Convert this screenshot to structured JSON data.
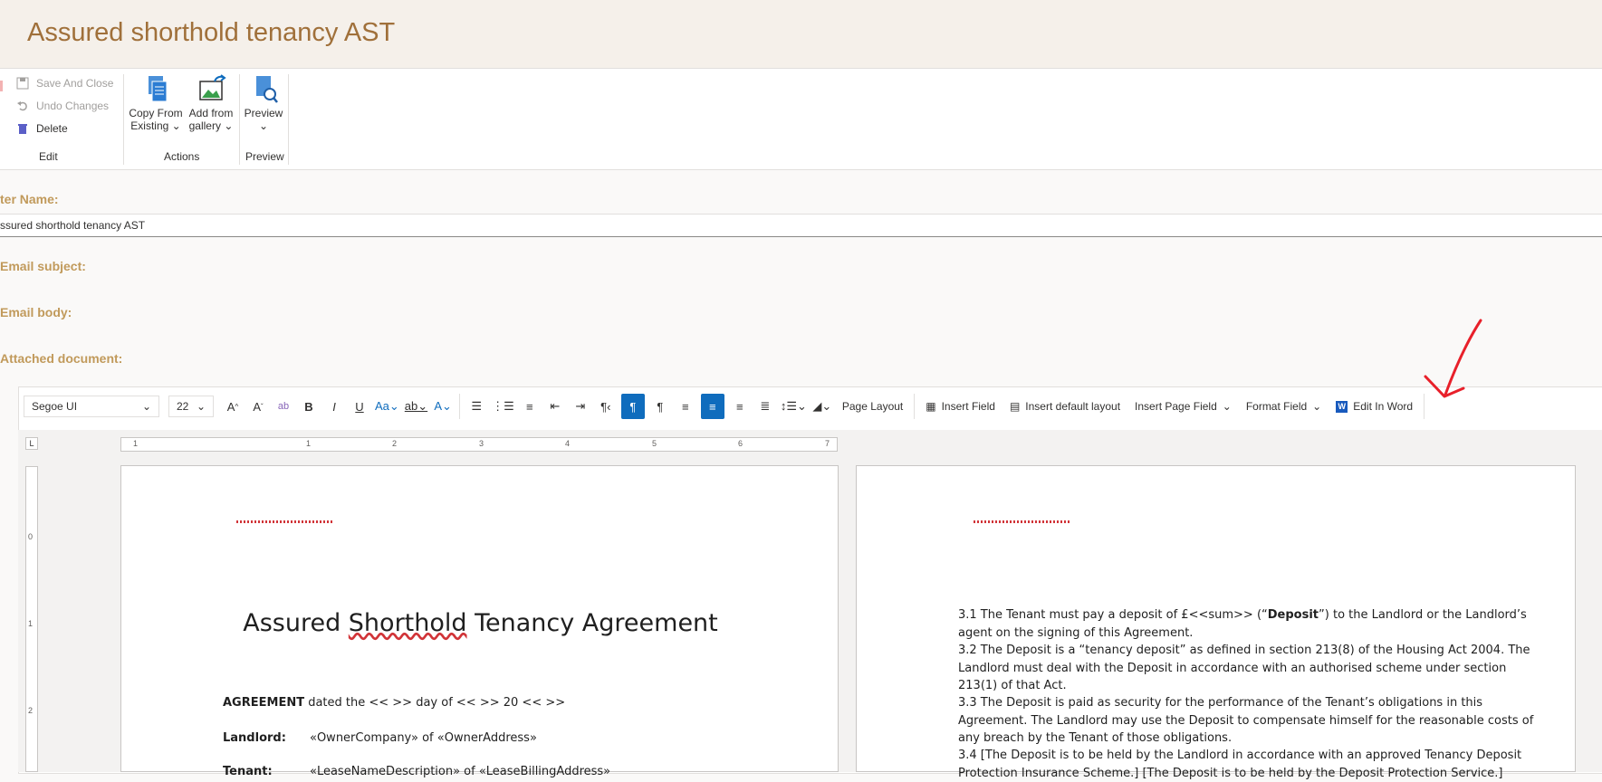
{
  "app": {
    "title": "Assured shorthold tenancy AST"
  },
  "ribbon": {
    "edit": {
      "save_close": "Save And Close",
      "undo": "Undo Changes",
      "delete": "Delete",
      "label": "Edit"
    },
    "actions": {
      "copy_line1": "Copy From",
      "copy_line2": "Existing",
      "gallery_line1": "Add from",
      "gallery_line2": "gallery",
      "label": "Actions"
    },
    "preview": {
      "button": "Preview",
      "label": "Preview"
    }
  },
  "form": {
    "name_label": "ter Name:",
    "name_value": "ssured shorthold tenancy AST",
    "email_subject_label": "Email subject:",
    "email_body_label": "Email body:",
    "attached_label": "Attached document:"
  },
  "toolbar": {
    "font": "Segoe UI",
    "size": "22",
    "page_layout": "Page Layout",
    "insert_field": "Insert Field",
    "insert_default_layout": "Insert default layout",
    "insert_page_field": "Insert Page Field",
    "format_field": "Format Field",
    "edit_in_word": "Edit In Word"
  },
  "ruler": {
    "marks": [
      "1",
      "1",
      "2",
      "3",
      "4",
      "5",
      "6",
      "7"
    ],
    "vmarks": [
      "0",
      "1",
      "2"
    ]
  },
  "document": {
    "page1": {
      "title_part1": "Assured ",
      "title_part2": "Shorthold",
      "title_part3": " Tenancy Agreement",
      "agreement_bold": "AGREEMENT",
      "agreement_text": " dated the <<   >> day of <<   >> 20 <<   >>",
      "landlord_label": "Landlord:",
      "landlord_value": "«OwnerCompany» of «OwnerAddress»",
      "tenant_label": "Tenant:",
      "tenant_value": "«LeaseNameDescription» of «LeaseBillingAddress»"
    },
    "page2": {
      "p31_before": "3.1 The Tenant must pay a deposit of £<<sum>> (“",
      "p31_bold": "Deposit",
      "p31_after": "”) to the Landlord or the Landlord’s agent on the signing of this Agreement.",
      "p32": "3.2 The Deposit is a “tenancy deposit” as defined in section 213(8) of the Housing Act 2004.  The Landlord must deal with the Deposit in accordance with an authorised scheme under section 213(1) of that Act.",
      "p33": "3.3 The Deposit is paid as security for the performance of the Tenant’s obligations in this Agreement.  The Landlord may use the Deposit to compensate himself for the reasonable costs of any breach by the Tenant of those obligations.",
      "p34": "3.4 [The Deposit is to be held by the Landlord in accordance with an approved Tenancy Deposit Protection Insurance Scheme.] [The Deposit is to be held by the Deposit Protection Service.]"
    }
  },
  "colors": {
    "title": "#a0703a",
    "label": "#c19a5b",
    "accent": "#0f6cbd",
    "annotation": "#e8202a"
  }
}
